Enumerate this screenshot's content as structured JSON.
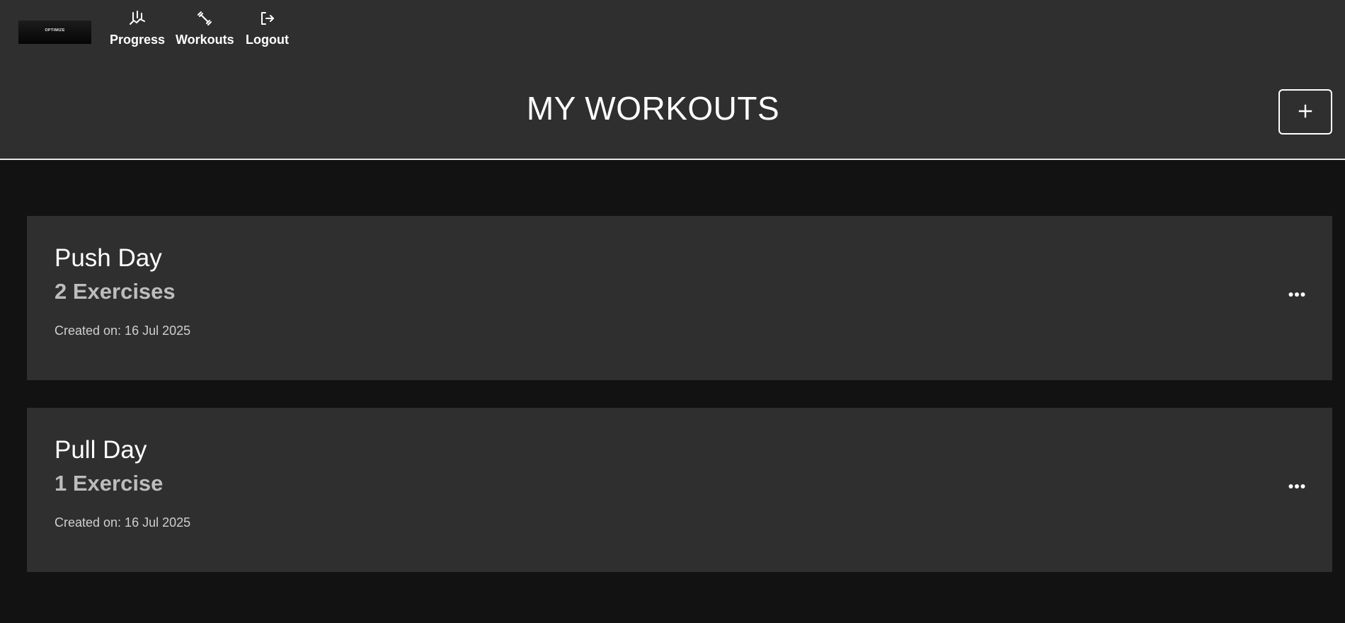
{
  "brand": {
    "logo_text": "OPTIMIZE"
  },
  "nav": [
    {
      "label": "Progress",
      "icon": "chart-icon"
    },
    {
      "label": "Workouts",
      "icon": "dumbbell-icon"
    },
    {
      "label": "Logout",
      "icon": "logout-icon"
    }
  ],
  "page": {
    "title": "MY WORKOUTS",
    "add_label": "+"
  },
  "workouts": [
    {
      "name": "Push Day",
      "exercises": "2 Exercises",
      "created": "Created on: 16 Jul 2025"
    },
    {
      "name": "Pull Day",
      "exercises": "1 Exercise",
      "created": "Created on: 16 Jul 2025"
    }
  ],
  "colors": {
    "header_bg": "#2f2f2f",
    "page_bg": "#121212",
    "card_bg": "#2f2f2f",
    "text": "#ffffff",
    "muted": "#bdbdbd"
  }
}
